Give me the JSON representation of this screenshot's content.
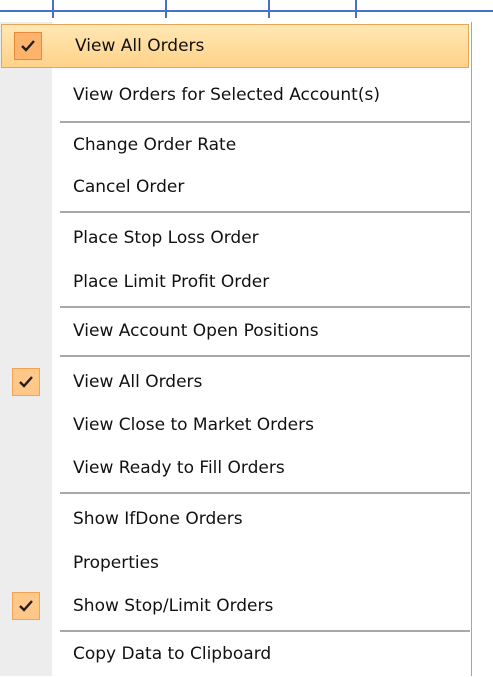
{
  "menu": {
    "items": [
      {
        "label": "View All Orders",
        "checked": true,
        "highlighted": true
      },
      {
        "label": "View Orders for Selected Account(s)",
        "checked": false
      },
      {
        "label": "Change Order Rate",
        "checked": false
      },
      {
        "label": "Cancel Order",
        "checked": false
      },
      {
        "label": "Place Stop Loss Order",
        "checked": false
      },
      {
        "label": "Place Limit Profit Order",
        "checked": false
      },
      {
        "label": "View Account Open Positions",
        "checked": false
      },
      {
        "label": "View All Orders",
        "checked": true
      },
      {
        "label": "View Close to Market Orders",
        "checked": false
      },
      {
        "label": "View Ready to Fill Orders",
        "checked": false
      },
      {
        "label": "Show IfDone Orders",
        "checked": false
      },
      {
        "label": "Properties",
        "checked": false
      },
      {
        "label": "Show Stop/Limit Orders",
        "checked": true
      },
      {
        "label": "Copy Data to Clipboard",
        "checked": false
      }
    ]
  },
  "colors": {
    "highlight": "#ffd28a",
    "check_background": "#ffc888",
    "gutter": "#eeeded",
    "grid_line": "#4a6fc9"
  },
  "icons": {
    "check": "checkmark-icon"
  }
}
